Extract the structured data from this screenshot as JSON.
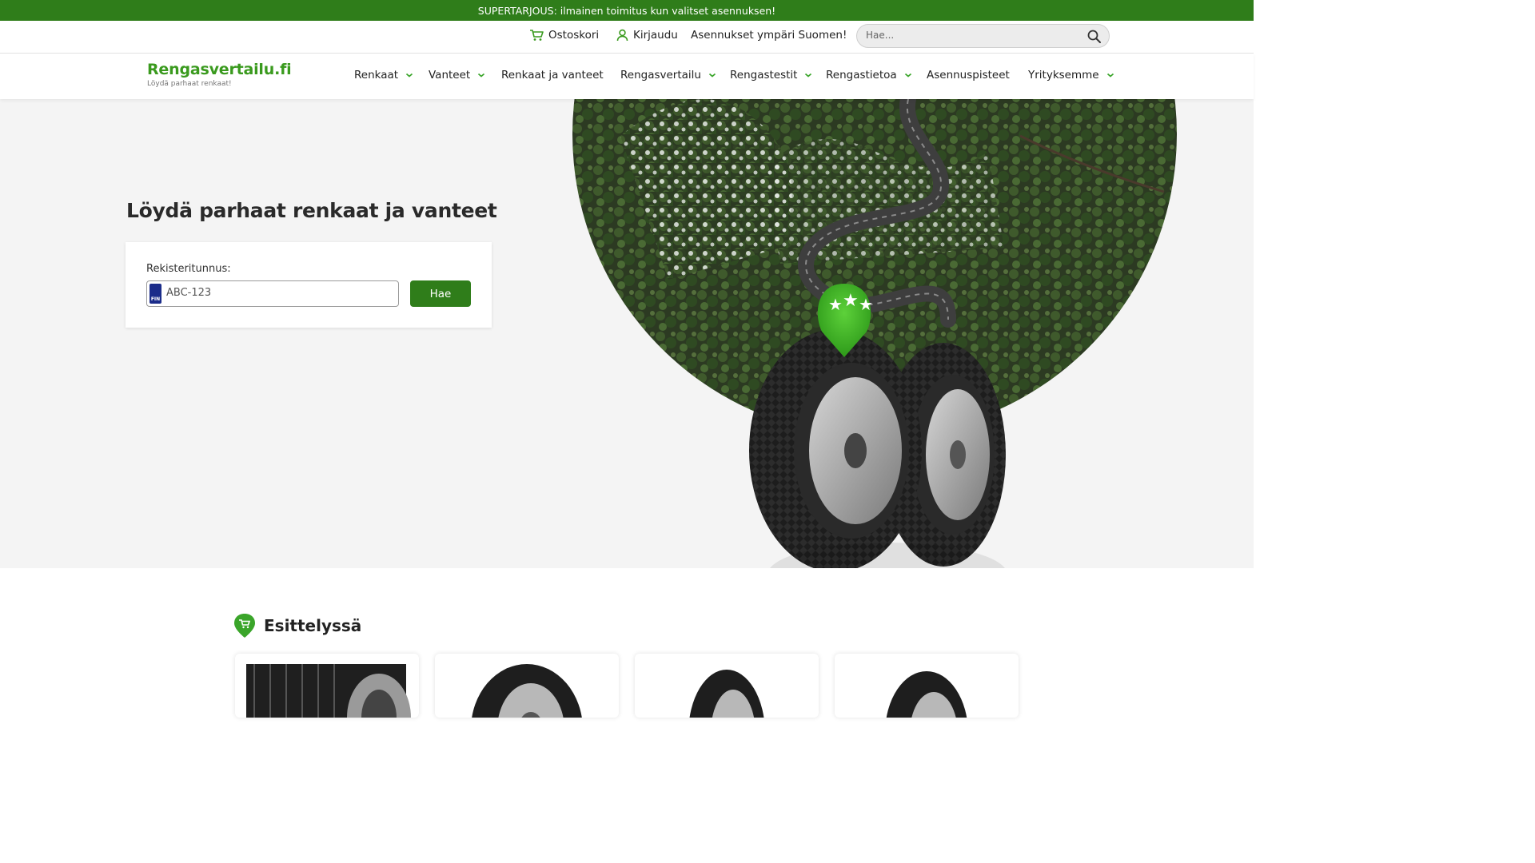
{
  "promo": {
    "text": "SUPERTARJOUS: ilmainen toimitus kun valitset asennuksen!"
  },
  "utility": {
    "cart_label": "Ostoskori",
    "login_label": "Kirjaudu",
    "tagline": "Asennukset ympäri Suomen!",
    "search_placeholder": "Hae..."
  },
  "logo": {
    "title": "Rengasvertailu.fi",
    "tagline": "Löydä parhaat renkaat!"
  },
  "nav": {
    "items": [
      {
        "label": "Renkaat",
        "dropdown": true
      },
      {
        "label": "Vanteet",
        "dropdown": true
      },
      {
        "label": "Renkaat ja vanteet",
        "dropdown": false
      },
      {
        "label": "Rengasvertailu",
        "dropdown": true
      },
      {
        "label": "Rengastestit",
        "dropdown": true
      },
      {
        "label": "Rengastietoa",
        "dropdown": true
      },
      {
        "label": "Asennuspisteet",
        "dropdown": false
      },
      {
        "label": "Yrityksemme",
        "dropdown": true
      }
    ]
  },
  "hero": {
    "title": "Löydä parhaat renkaat ja vanteet",
    "reg_label": "Rekisteritunnus:",
    "reg_placeholder": "ABC-123",
    "plate_country": "FIN",
    "search_button": "Hae"
  },
  "featured": {
    "title": "Esittelyssä",
    "cards": 4
  },
  "colors": {
    "brand_green": "#2f7d1a",
    "logo_green": "#3a9a1e",
    "hero_bg": "#f4f4f4",
    "chevron": "#3aa52a"
  },
  "icons": [
    "cart-icon",
    "user-icon",
    "search-icon",
    "chevron-down-icon",
    "fin-plate-flag",
    "shopping-pin-icon"
  ]
}
